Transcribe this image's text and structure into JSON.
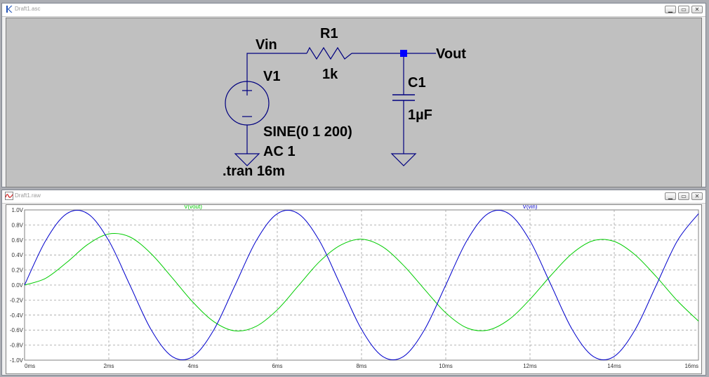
{
  "schematic_window": {
    "title": "Draft1.asc",
    "icon": "ltspice-k-icon",
    "buttons": [
      "minimize",
      "restore",
      "close"
    ]
  },
  "waveform_window": {
    "title": "Draft1.raw",
    "icon": "waveform-icon",
    "buttons": [
      "minimize",
      "restore",
      "close"
    ]
  },
  "schematic": {
    "net_vin": "Vin",
    "net_vout": "Vout",
    "r1_name": "R1",
    "r1_value": "1k",
    "c1_name": "C1",
    "c1_value": "1µF",
    "v1_name": "V1",
    "v1_value": "SINE(0 1 200)",
    "v1_ac": "AC 1",
    "directive": ".tran 16m",
    "wire_color": "#00007f",
    "node_color": "#0000ff"
  },
  "chart_data": {
    "type": "line",
    "x_unit": "ms",
    "xlim": [
      0,
      16
    ],
    "ylim": [
      -1.0,
      1.0
    ],
    "x_ticks": [
      "0ms",
      "2ms",
      "4ms",
      "6ms",
      "8ms",
      "10ms",
      "12ms",
      "14ms",
      "16ms"
    ],
    "y_ticks": [
      "1.0V",
      "0.8V",
      "0.6V",
      "0.4V",
      "0.2V",
      "0.0V",
      "-0.2V",
      "-0.4V",
      "-0.6V",
      "-0.8V",
      "-1.0V"
    ],
    "grid": true,
    "series": [
      {
        "name": "V(vout)",
        "color": "#00cc00",
        "x": [
          0,
          0.5,
          1,
          1.5,
          2,
          2.5,
          3,
          3.5,
          4,
          4.5,
          5,
          5.5,
          6,
          6.5,
          7,
          7.5,
          8,
          8.5,
          9,
          9.5,
          10,
          10.5,
          11,
          11.5,
          12,
          12.5,
          13,
          13.5,
          14,
          14.5,
          15,
          15.5,
          16
        ],
        "y": [
          0,
          0.09,
          0.3,
          0.54,
          0.68,
          0.64,
          0.42,
          0.1,
          -0.23,
          -0.49,
          -0.61,
          -0.55,
          -0.33,
          -0.01,
          0.31,
          0.53,
          0.61,
          0.51,
          0.26,
          -0.06,
          -0.37,
          -0.57,
          -0.6,
          -0.46,
          -0.19,
          0.13,
          0.42,
          0.59,
          0.58,
          0.4,
          0.11,
          -0.21,
          -0.48
        ]
      },
      {
        "name": "V(vin)",
        "color": "#0000cc",
        "x": [
          0,
          0.5,
          1,
          1.5,
          2,
          2.5,
          3,
          3.5,
          4,
          4.5,
          5,
          5.5,
          6,
          6.5,
          7,
          7.5,
          8,
          8.5,
          9,
          9.5,
          10,
          10.5,
          11,
          11.5,
          12,
          12.5,
          13,
          13.5,
          14,
          14.5,
          15,
          15.5,
          16
        ],
        "y": [
          0,
          0.59,
          0.95,
          0.95,
          0.59,
          0,
          -0.59,
          -0.95,
          -0.95,
          -0.59,
          0,
          0.59,
          0.95,
          0.95,
          0.59,
          0,
          -0.59,
          -0.95,
          -0.95,
          -0.59,
          0,
          0.59,
          0.95,
          0.95,
          0.59,
          0,
          -0.59,
          -0.95,
          -0.95,
          -0.59,
          0,
          0.59,
          0.95
        ]
      }
    ]
  }
}
